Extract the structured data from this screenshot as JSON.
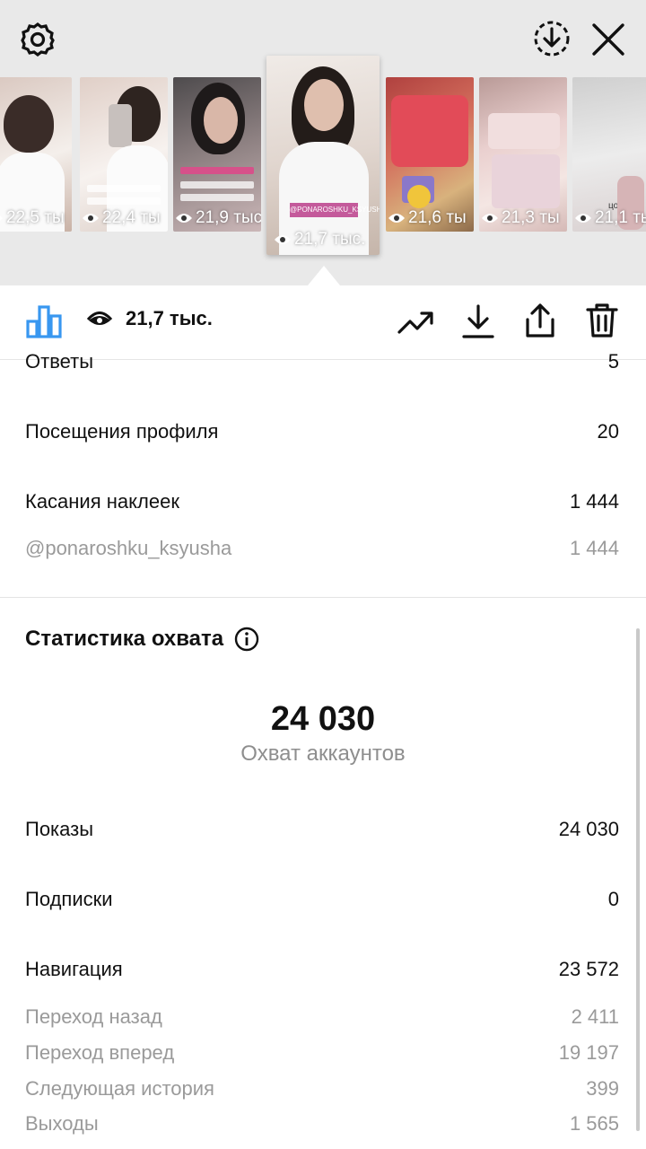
{
  "top": {
    "thumbnails": [
      {
        "views": "22,5 ты",
        "colors": [
          "#d9c7bf",
          "#f4efeb"
        ]
      },
      {
        "views": "22,4 ты",
        "colors": [
          "#e0cfc7",
          "#f7f2ef"
        ]
      },
      {
        "views": "21,9 тыс",
        "colors": [
          "#6d6a6c",
          "#b9a7a8"
        ]
      },
      {
        "views": "21,7 тыс.",
        "colors": [
          "#e8e0db",
          "#c8b8ae"
        ],
        "selected": true,
        "caption": "@PONAROSHKU_KSYUSHA"
      },
      {
        "views": "21,6 ты",
        "colors": [
          "#c7504f",
          "#d8b27d"
        ]
      },
      {
        "views": "21,3 ты",
        "colors": [
          "#e8c9c9",
          "#f2e0dd"
        ]
      },
      {
        "views": "21,1 ты",
        "colors": [
          "#d9d9d9",
          "#f1f1f1"
        ],
        "caption": "цон"
      }
    ]
  },
  "toolbar": {
    "views": "21,7 тыс.",
    "accent": "#3897f0"
  },
  "interactions": {
    "replies_label": "Ответы",
    "replies_value": "5",
    "profile_visits_label": "Посещения профиля",
    "profile_visits_value": "20",
    "sticker_taps_label": "Касания наклеек",
    "sticker_taps_value": "1 444",
    "sticker_mention_label": "@ponaroshku_ksyusha",
    "sticker_mention_value": "1 444"
  },
  "reach": {
    "title": "Статистика охвата",
    "accounts_reached_value": "24 030",
    "accounts_reached_label": "Охват аккаунтов",
    "impressions_label": "Показы",
    "impressions_value": "24 030",
    "follows_label": "Подписки",
    "follows_value": "0",
    "navigation_label": "Навигация",
    "navigation_value": "23 572",
    "back_label": "Переход назад",
    "back_value": "2 411",
    "forward_label": "Переход вперед",
    "forward_value": "19 197",
    "next_story_label": "Следующая история",
    "next_story_value": "399",
    "exits_label": "Выходы",
    "exits_value": "1 565"
  }
}
